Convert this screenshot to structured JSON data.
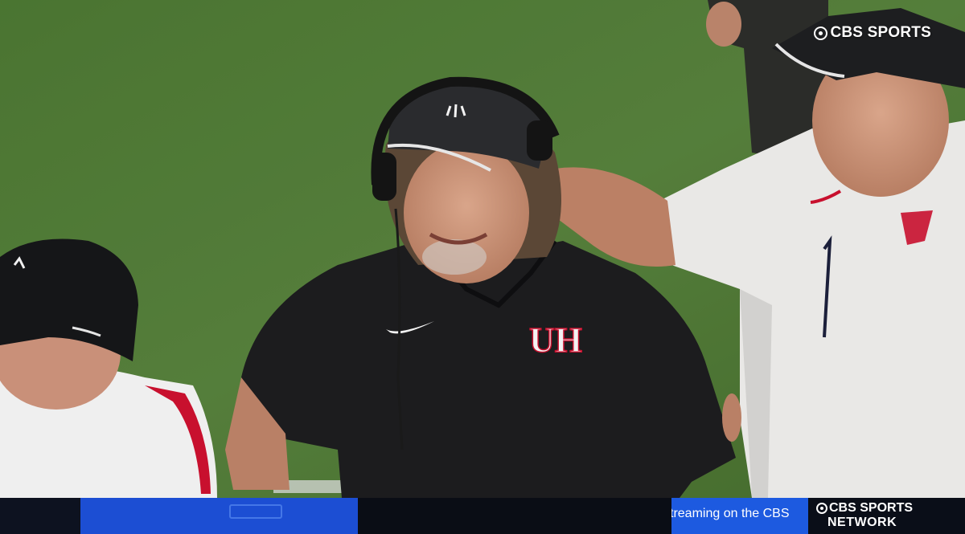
{
  "watermark": {
    "brand": "CBS SPORTS",
    "icon": "cbs-eye-icon"
  },
  "ticker": {
    "scroll_text": "treaming on the CBS",
    "network_line1": "CBS SPORTS",
    "network_line2": "NETWORK"
  },
  "colors": {
    "field_green": "#4f7a33",
    "ticker_blue": "#1c4ed3",
    "ticker_dark": "#0a0d15",
    "shirt_black": "#1c1c1e",
    "shirt_white": "#ecebea",
    "accent_red": "#c8102e"
  }
}
